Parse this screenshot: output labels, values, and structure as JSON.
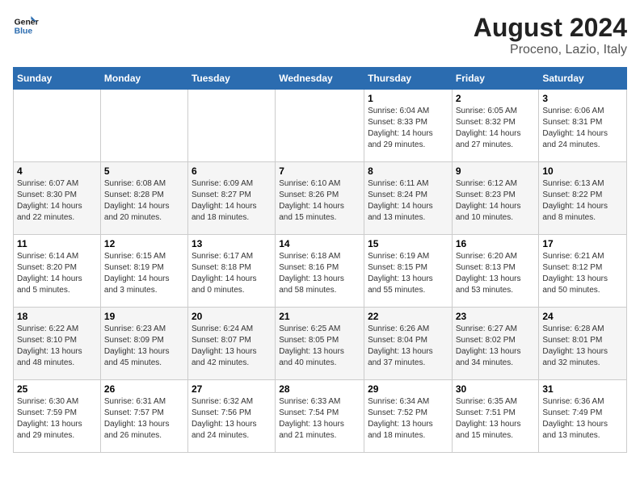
{
  "header": {
    "logo_line1": "General",
    "logo_line2": "Blue",
    "title": "August 2024",
    "subtitle": "Proceno, Lazio, Italy"
  },
  "weekdays": [
    "Sunday",
    "Monday",
    "Tuesday",
    "Wednesday",
    "Thursday",
    "Friday",
    "Saturday"
  ],
  "weeks": [
    [
      {
        "day": "",
        "info": ""
      },
      {
        "day": "",
        "info": ""
      },
      {
        "day": "",
        "info": ""
      },
      {
        "day": "",
        "info": ""
      },
      {
        "day": "1",
        "info": "Sunrise: 6:04 AM\nSunset: 8:33 PM\nDaylight: 14 hours\nand 29 minutes."
      },
      {
        "day": "2",
        "info": "Sunrise: 6:05 AM\nSunset: 8:32 PM\nDaylight: 14 hours\nand 27 minutes."
      },
      {
        "day": "3",
        "info": "Sunrise: 6:06 AM\nSunset: 8:31 PM\nDaylight: 14 hours\nand 24 minutes."
      }
    ],
    [
      {
        "day": "4",
        "info": "Sunrise: 6:07 AM\nSunset: 8:30 PM\nDaylight: 14 hours\nand 22 minutes."
      },
      {
        "day": "5",
        "info": "Sunrise: 6:08 AM\nSunset: 8:28 PM\nDaylight: 14 hours\nand 20 minutes."
      },
      {
        "day": "6",
        "info": "Sunrise: 6:09 AM\nSunset: 8:27 PM\nDaylight: 14 hours\nand 18 minutes."
      },
      {
        "day": "7",
        "info": "Sunrise: 6:10 AM\nSunset: 8:26 PM\nDaylight: 14 hours\nand 15 minutes."
      },
      {
        "day": "8",
        "info": "Sunrise: 6:11 AM\nSunset: 8:24 PM\nDaylight: 14 hours\nand 13 minutes."
      },
      {
        "day": "9",
        "info": "Sunrise: 6:12 AM\nSunset: 8:23 PM\nDaylight: 14 hours\nand 10 minutes."
      },
      {
        "day": "10",
        "info": "Sunrise: 6:13 AM\nSunset: 8:22 PM\nDaylight: 14 hours\nand 8 minutes."
      }
    ],
    [
      {
        "day": "11",
        "info": "Sunrise: 6:14 AM\nSunset: 8:20 PM\nDaylight: 14 hours\nand 5 minutes."
      },
      {
        "day": "12",
        "info": "Sunrise: 6:15 AM\nSunset: 8:19 PM\nDaylight: 14 hours\nand 3 minutes."
      },
      {
        "day": "13",
        "info": "Sunrise: 6:17 AM\nSunset: 8:18 PM\nDaylight: 14 hours\nand 0 minutes."
      },
      {
        "day": "14",
        "info": "Sunrise: 6:18 AM\nSunset: 8:16 PM\nDaylight: 13 hours\nand 58 minutes."
      },
      {
        "day": "15",
        "info": "Sunrise: 6:19 AM\nSunset: 8:15 PM\nDaylight: 13 hours\nand 55 minutes."
      },
      {
        "day": "16",
        "info": "Sunrise: 6:20 AM\nSunset: 8:13 PM\nDaylight: 13 hours\nand 53 minutes."
      },
      {
        "day": "17",
        "info": "Sunrise: 6:21 AM\nSunset: 8:12 PM\nDaylight: 13 hours\nand 50 minutes."
      }
    ],
    [
      {
        "day": "18",
        "info": "Sunrise: 6:22 AM\nSunset: 8:10 PM\nDaylight: 13 hours\nand 48 minutes."
      },
      {
        "day": "19",
        "info": "Sunrise: 6:23 AM\nSunset: 8:09 PM\nDaylight: 13 hours\nand 45 minutes."
      },
      {
        "day": "20",
        "info": "Sunrise: 6:24 AM\nSunset: 8:07 PM\nDaylight: 13 hours\nand 42 minutes."
      },
      {
        "day": "21",
        "info": "Sunrise: 6:25 AM\nSunset: 8:05 PM\nDaylight: 13 hours\nand 40 minutes."
      },
      {
        "day": "22",
        "info": "Sunrise: 6:26 AM\nSunset: 8:04 PM\nDaylight: 13 hours\nand 37 minutes."
      },
      {
        "day": "23",
        "info": "Sunrise: 6:27 AM\nSunset: 8:02 PM\nDaylight: 13 hours\nand 34 minutes."
      },
      {
        "day": "24",
        "info": "Sunrise: 6:28 AM\nSunset: 8:01 PM\nDaylight: 13 hours\nand 32 minutes."
      }
    ],
    [
      {
        "day": "25",
        "info": "Sunrise: 6:30 AM\nSunset: 7:59 PM\nDaylight: 13 hours\nand 29 minutes."
      },
      {
        "day": "26",
        "info": "Sunrise: 6:31 AM\nSunset: 7:57 PM\nDaylight: 13 hours\nand 26 minutes."
      },
      {
        "day": "27",
        "info": "Sunrise: 6:32 AM\nSunset: 7:56 PM\nDaylight: 13 hours\nand 24 minutes."
      },
      {
        "day": "28",
        "info": "Sunrise: 6:33 AM\nSunset: 7:54 PM\nDaylight: 13 hours\nand 21 minutes."
      },
      {
        "day": "29",
        "info": "Sunrise: 6:34 AM\nSunset: 7:52 PM\nDaylight: 13 hours\nand 18 minutes."
      },
      {
        "day": "30",
        "info": "Sunrise: 6:35 AM\nSunset: 7:51 PM\nDaylight: 13 hours\nand 15 minutes."
      },
      {
        "day": "31",
        "info": "Sunrise: 6:36 AM\nSunset: 7:49 PM\nDaylight: 13 hours\nand 13 minutes."
      }
    ]
  ]
}
